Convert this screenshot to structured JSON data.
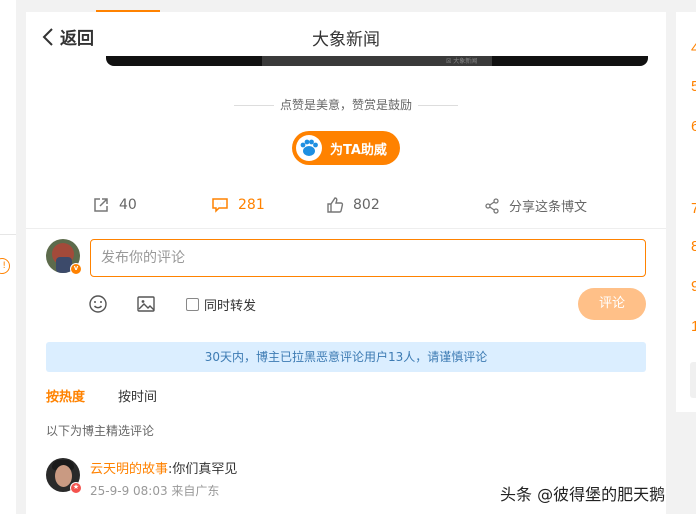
{
  "header": {
    "back_label": "返回",
    "title": "大象新闻"
  },
  "video": {
    "watermark_text": "☒ 大象新闻"
  },
  "reward": {
    "tagline": "点赞是美意，赞赏是鼓励",
    "boost_label": "为TA助威"
  },
  "actions": {
    "repost_count": "40",
    "comment_count": "281",
    "like_count": "802",
    "share_label": "分享这条博文",
    "icons": [
      "repost-icon",
      "comment-icon",
      "like-icon",
      "share-icon"
    ]
  },
  "composer": {
    "placeholder": "发布你的评论",
    "also_repost_label": "同时转发",
    "submit_label": "评论",
    "tools": [
      "emoji-icon",
      "image-icon"
    ]
  },
  "notice": {
    "text": "30天内，博主已拉黑恶意评论用户13人，请谨慎评论"
  },
  "sort_tabs": {
    "hot": "按热度",
    "time": "按时间"
  },
  "comments_section": {
    "curated_note": "以下为博主精选评论",
    "items": [
      {
        "username": "云天明的故事",
        "text": ":你们真罕见",
        "meta": "25-9-9 08:03 来自广东"
      }
    ]
  },
  "right_panel": {
    "numbers": [
      "4",
      "5",
      "6",
      "7",
      "8",
      "9",
      "1"
    ]
  },
  "watermark": {
    "text": "头条 @彼得堡的肥天鹅"
  },
  "colors": {
    "accent": "#ff8200",
    "notice_bg": "#dbeeff",
    "notice_text": "#3d7bb3",
    "submit_disabled": "#ffc088"
  }
}
